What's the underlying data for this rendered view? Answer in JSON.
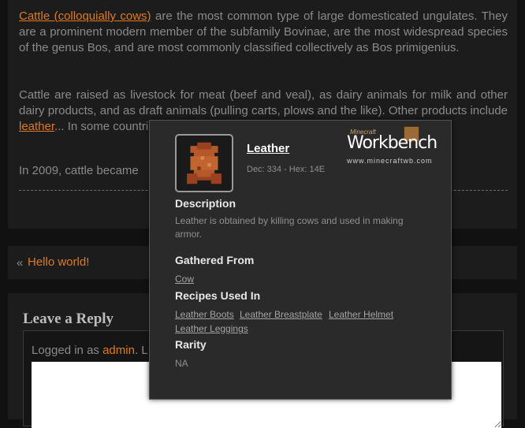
{
  "article": {
    "p1_link": "Cattle (colloquially cows)",
    "p1_text": " are the most common type of large domesticated ungulates. They are a prominent modern member of the subfamily Bovinae, are the most widespread species of the genus Bos, and are most commonly classified collectively as Bos primigenius.",
    "p2_text_a": "Cattle are raised as livestock for meat (beef and veal), as dairy animals for milk and other dairy products, and as draft animals (pulling carts, plows and the like). Other products include ",
    "p2_link": "leather",
    "p2_text_b": "...  In some countries, such as India, cattle are sacred. It is e...                                today.",
    "p3_text": "In 2009, cattle became"
  },
  "post_nav": {
    "arrow": "«",
    "prev_link": "Hello world!"
  },
  "reply": {
    "title": "Leave a Reply",
    "logged_prefix": "Logged in as ",
    "user": "admin",
    "logged_suffix": ". L"
  },
  "tooltip": {
    "item_name": "Leather",
    "dec_hex": "Dec: 334 - Hex: 14E",
    "logo": {
      "small": "Minecraft",
      "big": "Workbench",
      "url": "www.minecraftwb.com"
    },
    "description_title": "Description",
    "description": "Leather is obtained by killing cows and used in making armor.",
    "gathered_title": "Gathered From",
    "gathered_from": [
      "Cow"
    ],
    "recipes_title": "Recipes Used In",
    "recipes": [
      "Leather Boots",
      "Leather Breastplate",
      "Leather Helmet",
      "Leather Leggings"
    ],
    "rarity_title": "Rarity",
    "rarity": "NA",
    "leather_color": "#b5582a"
  }
}
